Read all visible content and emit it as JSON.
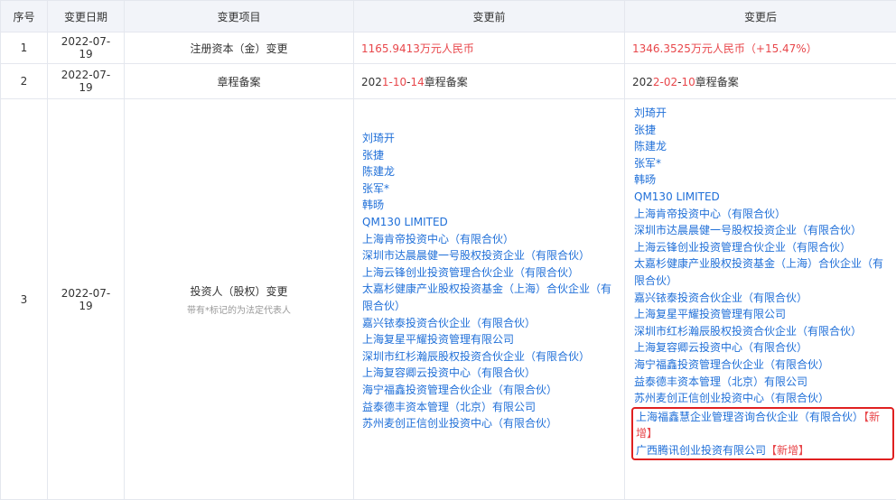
{
  "headers": {
    "seq": "序号",
    "date": "变更日期",
    "item": "变更项目",
    "before": "变更前",
    "after": "变更后"
  },
  "rows": [
    {
      "seq": "1",
      "date": "2022-07-19",
      "item": "注册资本（金）变更",
      "before": "1165.9413万元人民币",
      "after": "1346.3525万元人民币（+15.47%）"
    },
    {
      "seq": "2",
      "date": "2022-07-19",
      "item": "章程备案",
      "before_prefix": "202",
      "before_hl1": "1-10",
      "before_mid": "-",
      "before_hl2": "14",
      "before_suffix": "章程备案",
      "after_prefix": "202",
      "after_hl1": "2-02",
      "after_mid": "-",
      "after_hl2": "10",
      "after_suffix": "章程备案"
    },
    {
      "seq": "3",
      "date": "2022-07-19",
      "item": "投资人（股权）变更",
      "note": "带有*标记的为法定代表人",
      "before": [
        "刘琦开",
        "张捷",
        "陈建龙",
        "张军*",
        "韩旸",
        "QM130 LIMITED",
        "上海肯帝投资中心（有限合伙）",
        "深圳市达晨晨健一号股权投资企业（有限合伙）",
        "上海云锋创业投资管理合伙企业（有限合伙）",
        "太嘉杉健康产业股权投资基金（上海）合伙企业（有限合伙）",
        "嘉兴铱泰投资合伙企业（有限合伙）",
        "上海复星平耀投资管理有限公司",
        "深圳市红杉瀚辰股权投资合伙企业（有限合伙）",
        "上海复容卿云投资中心（有限合伙）",
        "海宁福鑫投资管理合伙企业（有限合伙）",
        "益泰德丰资本管理（北京）有限公司",
        "苏州麦创正信创业投资中心（有限合伙）"
      ],
      "after": [
        "刘琦开",
        "张捷",
        "陈建龙",
        "张军*",
        "韩旸",
        "QM130 LIMITED",
        "上海肯帝投资中心（有限合伙）",
        "深圳市达晨晨健一号股权投资企业（有限合伙）",
        "上海云锋创业投资管理合伙企业（有限合伙）",
        "太嘉杉健康产业股权投资基金（上海）合伙企业（有限合伙）",
        "嘉兴铱泰投资合伙企业（有限合伙）",
        "上海复星平耀投资管理有限公司",
        "深圳市红杉瀚辰股权投资合伙企业（有限合伙）",
        "上海复容卿云投资中心（有限合伙）",
        "海宁福鑫投资管理合伙企业（有限合伙）",
        "益泰德丰资本管理（北京）有限公司",
        "苏州麦创正信创业投资中心（有限合伙）"
      ],
      "after_new": [
        {
          "name": "上海福鑫慧企业管理咨询合伙企业（有限合伙）",
          "tag": "【新增】"
        },
        {
          "name": "广西腾讯创业投资有限公司",
          "tag": "【新增】"
        }
      ]
    }
  ]
}
